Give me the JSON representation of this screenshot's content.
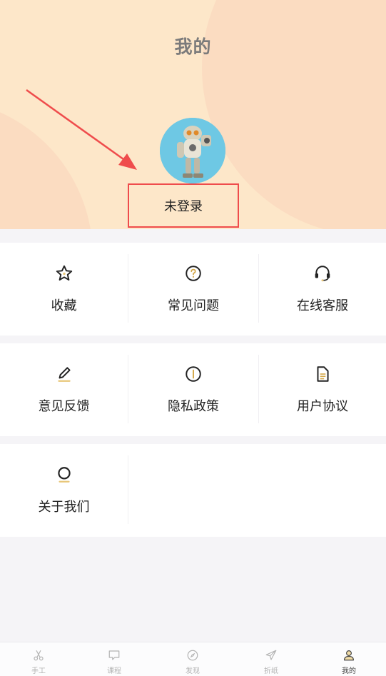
{
  "header": {
    "title": "我的",
    "login_status": "未登录"
  },
  "grid": [
    {
      "label": "收藏",
      "icon": "star-icon"
    },
    {
      "label": "常见问题",
      "icon": "question-icon"
    },
    {
      "label": "在线客服",
      "icon": "headset-icon"
    },
    {
      "label": "意见反馈",
      "icon": "pencil-icon"
    },
    {
      "label": "隐私政策",
      "icon": "info-icon"
    },
    {
      "label": "用户协议",
      "icon": "document-icon"
    },
    {
      "label": "关于我们",
      "icon": "circle-icon"
    }
  ],
  "tabbar": [
    {
      "label": "手工",
      "icon": "scissors-icon"
    },
    {
      "label": "课程",
      "icon": "chat-bubble-icon"
    },
    {
      "label": "发现",
      "icon": "compass-icon"
    },
    {
      "label": "折纸",
      "icon": "paper-plane-icon"
    },
    {
      "label": "我的",
      "icon": "user-icon"
    }
  ],
  "colors": {
    "header_bg": "#fde7c9",
    "accent": "#e8c77a",
    "highlight_box": "#ef4c4c"
  }
}
